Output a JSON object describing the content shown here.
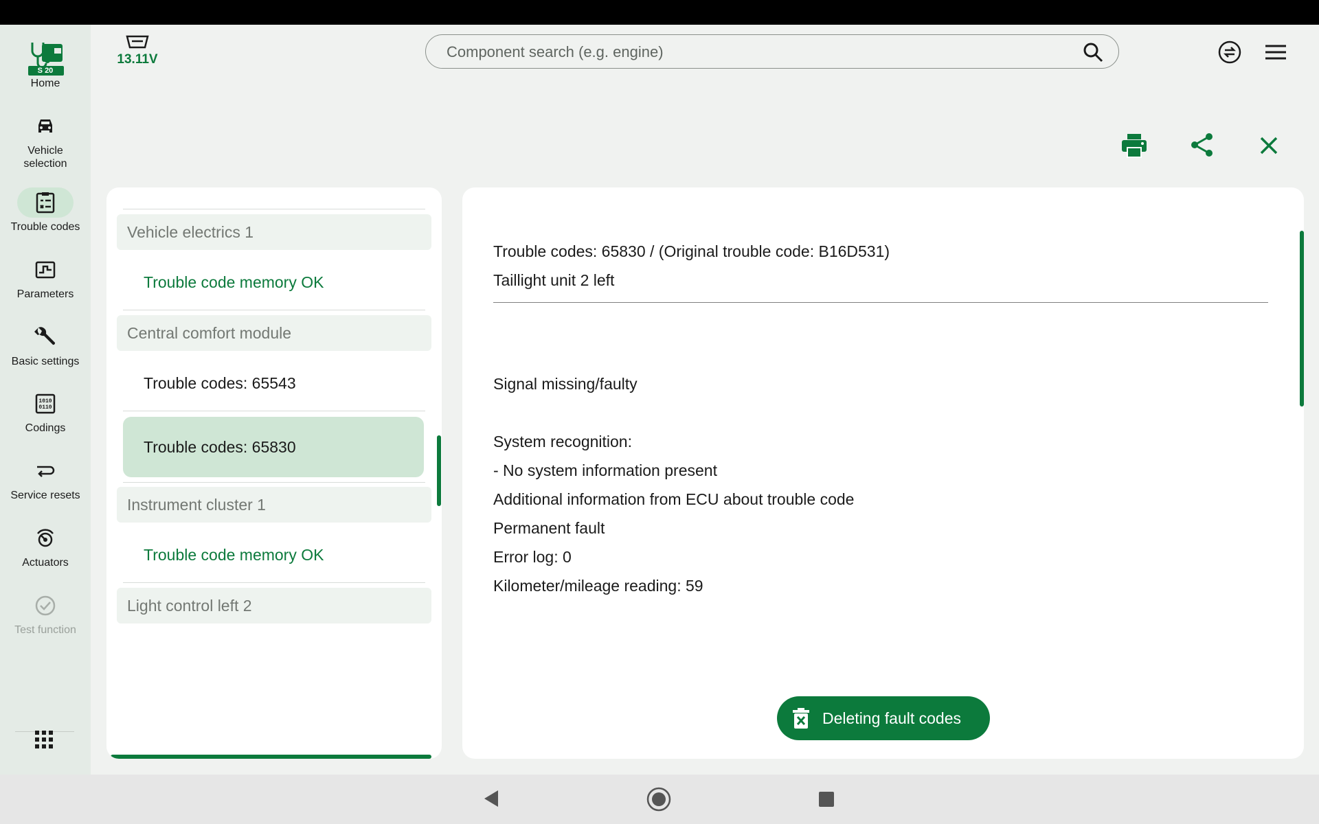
{
  "device": {
    "model": "S 20",
    "voltage": "13.11V"
  },
  "sidebar": {
    "items": [
      {
        "label": "Home"
      },
      {
        "label": "Vehicle selection"
      },
      {
        "label": "Trouble codes"
      },
      {
        "label": "Parameters"
      },
      {
        "label": "Basic settings"
      },
      {
        "label": "Codings"
      },
      {
        "label": "Service resets"
      },
      {
        "label": "Actuators"
      },
      {
        "label": "Test function"
      }
    ],
    "active": "Trouble codes",
    "disabled": "Test function"
  },
  "search": {
    "placeholder": "Component search (e.g. engine)"
  },
  "ecu_list": [
    {
      "name": "Vehicle electrics 1",
      "entries": [
        "Trouble code memory OK"
      ]
    },
    {
      "name": "Central comfort module",
      "entries": [
        "Trouble codes: 65543",
        "Trouble codes: 65830"
      ]
    },
    {
      "name": "Instrument cluster 1",
      "entries": [
        "Trouble code memory OK"
      ]
    },
    {
      "name": "Light control left 2",
      "entries": []
    }
  ],
  "selected_entry": "Trouble codes: 65830",
  "detail": {
    "title": "Trouble codes: 65830 / (Original trouble code: B16D531)",
    "component": "Taillight unit 2 left",
    "description": "Signal missing/faulty",
    "lines": [
      "System recognition:",
      "- No system information present",
      "Additional information from ECU about trouble code",
      "Permanent fault",
      "Error log: 0",
      "Kilometer/mileage reading: 59"
    ],
    "delete_label": "Deleting fault codes"
  },
  "colors": {
    "accent": "#0c7a3c",
    "selected_bg": "#cfe6d5",
    "sidebar_bg": "#e4ebe6",
    "page_bg": "#f0f2f0"
  }
}
